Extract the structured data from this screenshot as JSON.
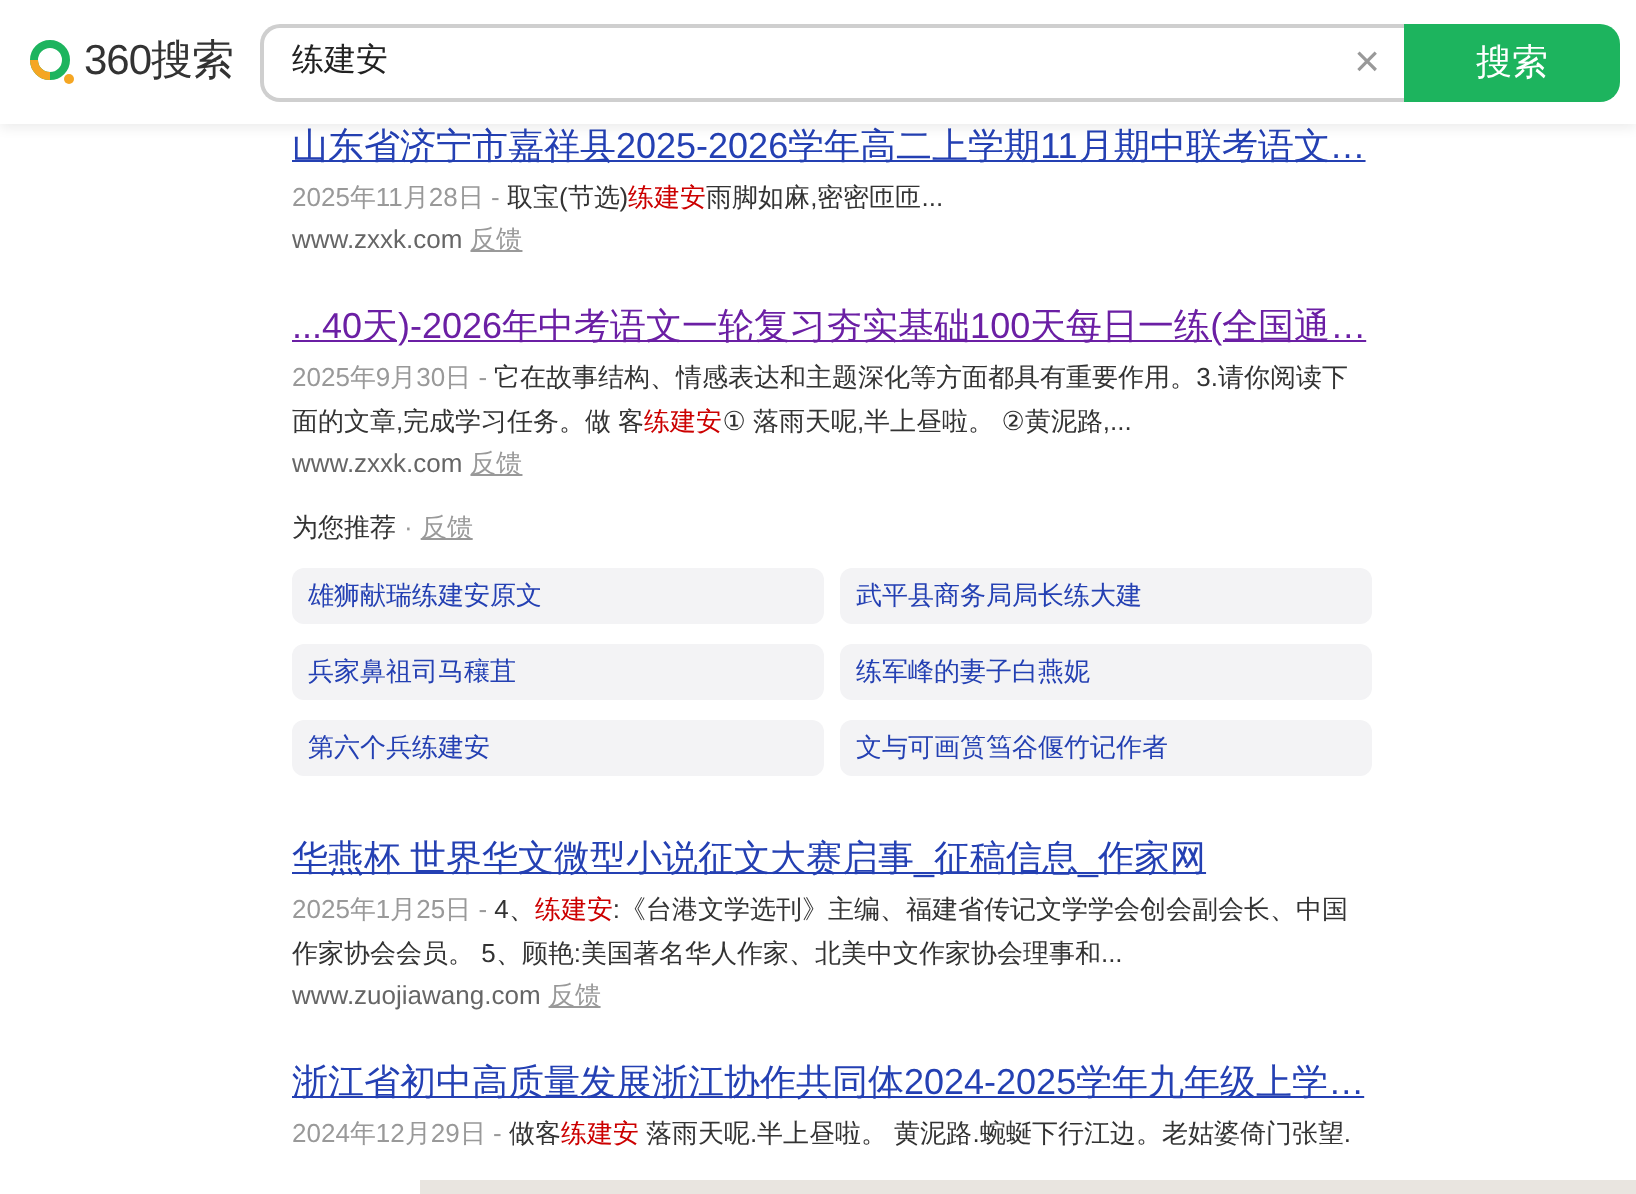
{
  "header": {
    "logo": "360搜索",
    "query": "练建安",
    "clear": "×",
    "search_button": "搜索"
  },
  "results": [
    {
      "kind": "result",
      "title": "山东省济宁市嘉祥县2025-2026学年高二上学期11月期中联考语文…",
      "visited": false,
      "date": "2025年11月28日",
      "separator": "-",
      "snippet": [
        {
          "text": "取宝(节选)",
          "highlight": false
        },
        {
          "text": "练建安",
          "highlight": true
        },
        {
          "text": "雨脚如麻,密密匝匝...",
          "highlight": false
        }
      ],
      "url": "www.zxxk.com",
      "feedback": "反馈"
    },
    {
      "kind": "result",
      "title": "...40天)-2026年中考语文一轮复习夯实基础100天每日一练(全国通…",
      "visited": true,
      "date": "2025年9月30日",
      "separator": "-",
      "snippet": [
        {
          "text": "它在故事结构、情感表达和主题深化等方面都具有重要作用。3.请你阅读下面的文章,完成学习任务。做 客",
          "highlight": false
        },
        {
          "text": "练建安",
          "highlight": true
        },
        {
          "text": "① 落雨天呢,半上昼啦。 ②黄泥路,...",
          "highlight": false
        }
      ],
      "url": "www.zxxk.com",
      "feedback": "反馈"
    },
    {
      "kind": "recommend",
      "label": "为您推荐",
      "separator": "·",
      "feedback": "反馈",
      "items": [
        "雄狮献瑞练建安原文",
        "武平县商务局局长练大建",
        "兵家鼻祖司马穰苴",
        "练军峰的妻子白燕妮",
        "第六个兵练建安",
        "文与可画筼筜谷偃竹记作者"
      ]
    },
    {
      "kind": "result",
      "title": "华燕杯 世界华文微型小说征文大赛启事_征稿信息_作家网",
      "visited": false,
      "date": "2025年1月25日",
      "separator": "-",
      "snippet": [
        {
          "text": "4、",
          "highlight": false
        },
        {
          "text": "练建安",
          "highlight": true
        },
        {
          "text": ":《台港文学选刊》主编、福建省传记文学学会创会副会长、中国作家协会会员。 5、顾艳:美国著名华人作家、北美中文作家协会理事和...",
          "highlight": false
        }
      ],
      "url": "www.zuojiawang.com",
      "feedback": "反馈"
    },
    {
      "kind": "result",
      "title": "浙江省初中高质量发展浙江协作共同体2024-2025学年九年级上学…",
      "visited": false,
      "date": "2024年12月29日",
      "separator": "-",
      "snippet": [
        {
          "text": "做客",
          "highlight": false
        },
        {
          "text": "练建安",
          "highlight": true
        },
        {
          "text": " 落雨天呢.半上昼啦。 黄泥路.蜿蜒下行江边。老姑婆倚门张望.",
          "highlight": false
        }
      ]
    }
  ]
}
